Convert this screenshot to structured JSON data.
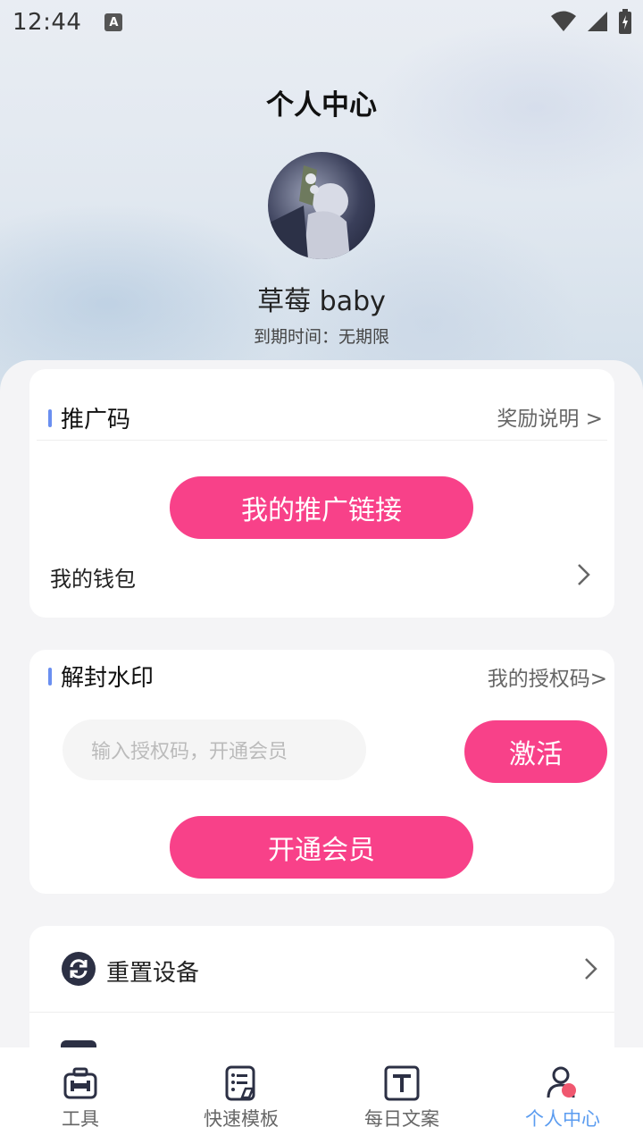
{
  "status_bar": {
    "time": "12:44",
    "notif_icon_letter": "A"
  },
  "header": {
    "title": "个人中心"
  },
  "profile": {
    "username": "草莓 baby",
    "expire_text": "到期时间：无期限"
  },
  "promo_card": {
    "title": "推广码",
    "link": "奖励说明 >",
    "button": "我的推广链接",
    "wallet_label": "我的钱包"
  },
  "watermark_card": {
    "title": "解封水印",
    "link": "我的授权码>",
    "input_placeholder": "输入授权码，开通会员",
    "activate_button": "激活",
    "vip_button": "开通会员"
  },
  "settings_list": {
    "reset_label": "重置设备"
  },
  "tabbar": {
    "items": [
      {
        "label": "工具",
        "icon": "toolbox-icon"
      },
      {
        "label": "快速模板",
        "icon": "template-icon"
      },
      {
        "label": "每日文案",
        "icon": "text-icon"
      },
      {
        "label": "个人中心",
        "icon": "profile-icon"
      }
    ],
    "active_index": 3
  },
  "colors": {
    "accent_pink": "#f84189",
    "accent_blue": "#5b9cf0",
    "section_bar": "#6a8ff0"
  }
}
